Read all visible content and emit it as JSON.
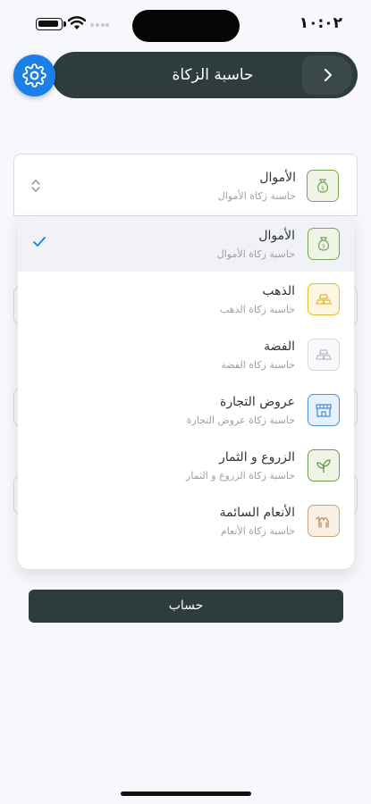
{
  "status": {
    "time": "١٠:٠٢"
  },
  "header": {
    "title": "حاسبة الزكاة",
    "back_icon": "chevron-right-icon",
    "settings_icon": "gear-icon"
  },
  "selected": {
    "title": "الأموال",
    "subtitle": "حاسبة زكاة الأموال",
    "icon": "money-bag-icon"
  },
  "options": [
    {
      "title": "الأموال",
      "subtitle": "حاسبة زكاة الأموال",
      "icon": "money-bag-icon",
      "color": "#7aa35a",
      "bg": "#eef5e6",
      "selected": true
    },
    {
      "title": "الذهب",
      "subtitle": "حاسبة زكاة الذهب",
      "icon": "gold-icon",
      "color": "#e2b93b",
      "bg": "#fdf6e0",
      "selected": false
    },
    {
      "title": "الفضة",
      "subtitle": "حاسبة زكاة الفضة",
      "icon": "silver-icon",
      "color": "#b9bec4",
      "bg": "#f8f9fa",
      "selected": false
    },
    {
      "title": "عروض التجارة",
      "subtitle": "حاسبة زكاة عروض التجارة",
      "icon": "store-icon",
      "color": "#4a8fd8",
      "bg": "#e7f0fb",
      "selected": false
    },
    {
      "title": "الزروع و الثمار",
      "subtitle": "حاسبة زكاة الزروع و الثمار",
      "icon": "plant-icon",
      "color": "#6e9a50",
      "bg": "#eef5e6",
      "selected": false
    },
    {
      "title": "الأنعام السائمة",
      "subtitle": "حاسبة زكاة الأنعام",
      "icon": "camel-icon",
      "color": "#b89060",
      "bg": "#f8f0e4",
      "selected": false
    }
  ],
  "calculate_label": "حساب",
  "colors": {
    "primary_dark": "#2f3c3e",
    "accent_blue": "#1a7fe6"
  }
}
